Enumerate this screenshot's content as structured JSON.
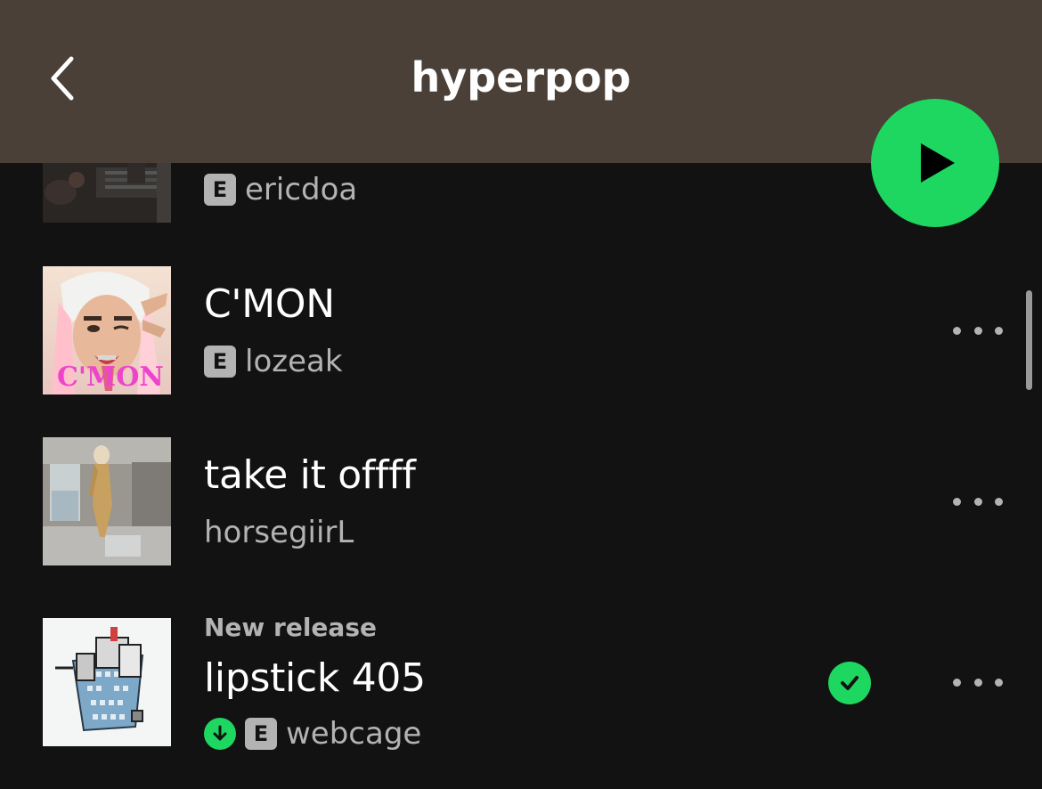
{
  "header": {
    "title": "hyperpop",
    "background_color": "#4a4038",
    "back_icon": "chevron-left-icon",
    "play_icon": "play-icon",
    "accent_color": "#1ed760"
  },
  "tracks": [
    {
      "title": "",
      "artist": "ericdoa",
      "explicit": true,
      "artwork": "studio photo"
    },
    {
      "title": "C'MON",
      "artist": "lozeak",
      "explicit": true,
      "artwork_text": "C'MON"
    },
    {
      "title": "take it offff",
      "artist": "horsegiirL",
      "explicit": false
    },
    {
      "label": "New release",
      "title": "lipstick 405",
      "artist": "webcage",
      "explicit": true,
      "downloaded": true,
      "added": true
    }
  ],
  "badges": {
    "explicit": "E"
  }
}
